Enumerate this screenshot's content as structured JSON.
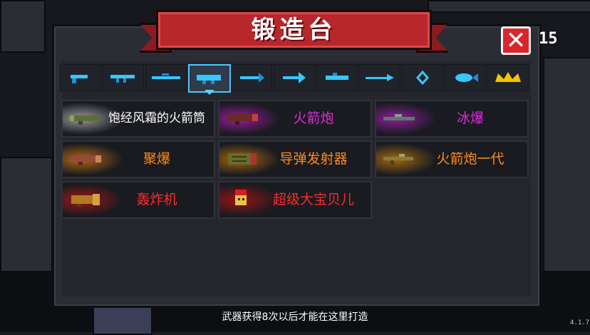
{
  "title": "锻造台",
  "close_icon": "close-x-icon",
  "counter": "15",
  "tabs": [
    {
      "icon": "pistol-icon",
      "selected": false
    },
    {
      "icon": "rifle-icon",
      "selected": false
    },
    {
      "icon": "sniper-icon",
      "selected": false
    },
    {
      "icon": "rocket-launcher-icon",
      "selected": true
    },
    {
      "icon": "bow-icon",
      "selected": false
    },
    {
      "icon": "arrow-icon",
      "selected": false
    },
    {
      "icon": "laser-icon",
      "selected": false
    },
    {
      "icon": "spear-icon",
      "selected": false
    },
    {
      "icon": "staff-icon",
      "selected": false
    },
    {
      "icon": "fish-gun-icon",
      "selected": false
    },
    {
      "icon": "crown-icon",
      "selected": false
    }
  ],
  "items": [
    {
      "label": "饱经风霜的火箭筒",
      "color": "#ffffff",
      "glow": "#9a9a9a"
    },
    {
      "label": "火箭炮",
      "color": "#e02bdd",
      "glow": "#9b1a9e"
    },
    {
      "label": "冰爆",
      "color": "#e02bdd",
      "glow": "#8f1d9a"
    },
    {
      "label": "聚爆",
      "color": "#ff8a1c",
      "glow": "#b26812"
    },
    {
      "label": "导弹发射器",
      "color": "#ff8a1c",
      "glow": "#a8650f"
    },
    {
      "label": "火箭炮一代",
      "color": "#ff8a1c",
      "glow": "#a06812"
    },
    {
      "label": "轰炸机",
      "color": "#ff2a2a",
      "glow": "#a01515"
    },
    {
      "label": "超级大宝贝儿",
      "color": "#ff2a2a",
      "glow": "#9a1313"
    }
  ],
  "footer": "武器获得8次以后才能在这里打造",
  "version": "4.1.7",
  "colors": {
    "selected_tab_border": "#4cc7ff",
    "icon_cyan": "#37c6ff",
    "title_red": "#b7272b"
  }
}
